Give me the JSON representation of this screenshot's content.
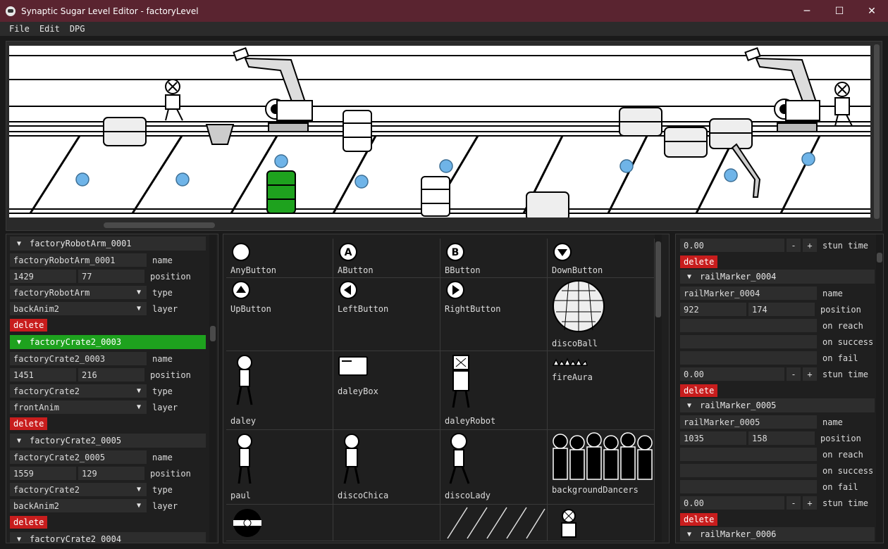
{
  "window": {
    "title": "Synaptic Sugar Level Editor - factoryLevel",
    "minimize": "─",
    "maximize": "☐",
    "close": "✕"
  },
  "menu": [
    "File",
    "Edit",
    "DPG"
  ],
  "entities": [
    {
      "header": "factoryRobotArm_0001",
      "name": "factoryRobotArm_0001",
      "pos_x": "1429",
      "pos_y": "77",
      "type": "factoryRobotArm",
      "layer": "backAnim2",
      "selected": false
    },
    {
      "header": "factoryCrate2_0003",
      "name": "factoryCrate2_0003",
      "pos_x": "1451",
      "pos_y": "216",
      "type": "factoryCrate2",
      "layer": "frontAnim",
      "selected": true
    },
    {
      "header": "factoryCrate2_0005",
      "name": "factoryCrate2_0005",
      "pos_x": "1559",
      "pos_y": "129",
      "type": "factoryCrate2",
      "layer": "backAnim2",
      "selected": false
    }
  ],
  "entity_last_header": "factoryCrate2_0004",
  "labels": {
    "name": "name",
    "position": "position",
    "type": "type",
    "layer": "layer",
    "delete": "delete",
    "on_reach": "on reach",
    "on_success": "on success",
    "on_fail": "on fail",
    "stun_time": "stun time",
    "minus": "-",
    "plus": "+"
  },
  "assets": [
    {
      "name": "AnyButton",
      "icon": "circle-button-icon"
    },
    {
      "name": "AButton",
      "icon": "a-button-icon"
    },
    {
      "name": "BButton",
      "icon": "b-button-icon"
    },
    {
      "name": "DownButton",
      "icon": "down-button-icon"
    },
    {
      "name": "UpButton",
      "icon": "up-button-icon"
    },
    {
      "name": "LeftButton",
      "icon": "left-button-icon"
    },
    {
      "name": "RightButton",
      "icon": "right-button-icon"
    },
    {
      "name": "discoBall",
      "icon": "disco-ball-icon"
    },
    {
      "name": "daley",
      "icon": "character-icon"
    },
    {
      "name": "daleyBox",
      "icon": "box-icon"
    },
    {
      "name": "daleyRobot",
      "icon": "robot-icon"
    },
    {
      "name": "fireAura",
      "icon": "fire-icon"
    },
    {
      "name": "paul",
      "icon": "character-icon"
    },
    {
      "name": "discoChica",
      "icon": "character-icon"
    },
    {
      "name": "discoLady",
      "icon": "character-icon"
    },
    {
      "name": "backgroundDancers",
      "icon": "dancers-icon"
    }
  ],
  "rail_top": {
    "stun_value": "0.00"
  },
  "rail_markers": [
    {
      "header": "railMarker_0004",
      "name": "railMarker_0004",
      "pos_x": "922",
      "pos_y": "174",
      "on_reach": "",
      "on_success": "",
      "on_fail": "",
      "stun_value": "0.00"
    },
    {
      "header": "railMarker_0005",
      "name": "railMarker_0005",
      "pos_x": "1035",
      "pos_y": "158",
      "on_reach": "",
      "on_success": "",
      "on_fail": "",
      "stun_value": "0.00"
    }
  ],
  "rail_last_header": "railMarker_0006",
  "colors": {
    "title_bar": "#5a2430",
    "selected_header": "#1ea21e",
    "delete_button": "#c81d1d",
    "rail_marker": "#6fb4e8",
    "selected_crate": "#1ea21e"
  }
}
